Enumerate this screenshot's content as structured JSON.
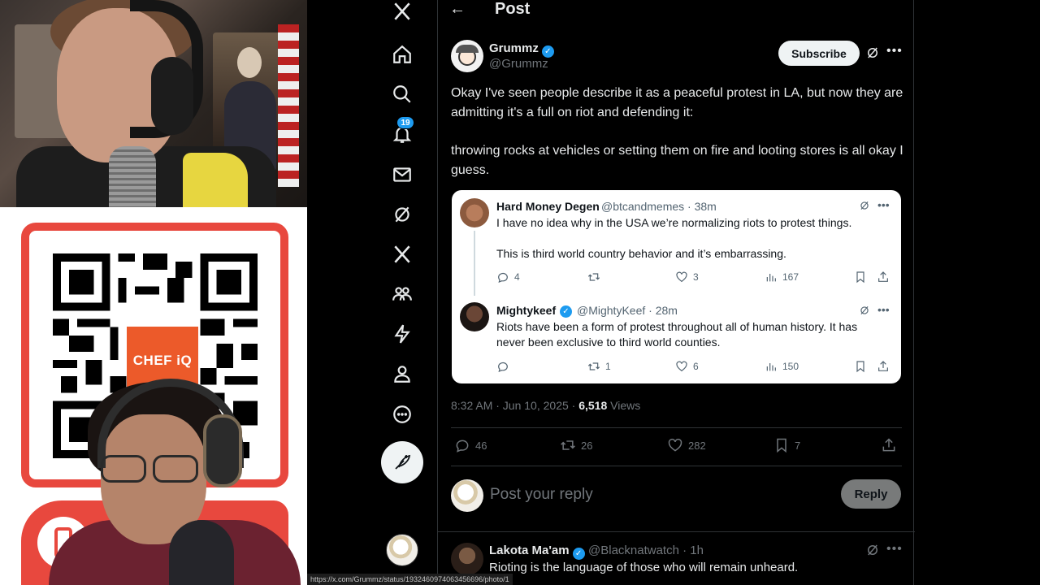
{
  "overlay": {
    "qr_logo_text": "CHEF iQ"
  },
  "nav": {
    "notification_count": "19"
  },
  "header": {
    "title": "Post"
  },
  "post": {
    "author_name": "Grummz",
    "author_handle": "@Grummz",
    "subscribe_label": "Subscribe",
    "text_line1": "Okay I've seen people describe it as a peaceful protest in LA, but now they are admitting it's a full on riot and defending it:",
    "text_line2": "throwing rocks at vehicles or setting them on fire and looting stores is all okay I guess.",
    "timestamp": "8:32 AM · Jun 10, 2025 · ",
    "views_count": "6,518",
    "views_label": " Views",
    "stats": {
      "replies": "46",
      "reposts": "26",
      "likes": "282",
      "bookmarks": "7"
    }
  },
  "quote": {
    "first": {
      "name": "Hard Money Degen",
      "meta": "@btcandmemes · 38m",
      "text1": "I have no idea why in the USA we’re normalizing riots to protest things.",
      "text2": "This is third world country behavior and it’s embarrassing.",
      "replies": "4",
      "reposts": "",
      "likes": "3",
      "views": "167"
    },
    "second": {
      "name": "Mightykeef",
      "meta": "@MightyKeef · 28m",
      "text": "Riots have been a form of protest throughout all of human history. It has never been exclusive to third world counties.",
      "replies": "",
      "reposts": "1",
      "likes": "6",
      "views": "150"
    }
  },
  "reply_box": {
    "placeholder": "Post your reply",
    "button_label": "Reply"
  },
  "next_reply": {
    "name": "Lakota Ma'am",
    "meta": "@Blacknatwatch · 1h",
    "text": "Rioting is the language of those who will remain unheard."
  },
  "statusbar": {
    "url": "https://x.com/Grummz/status/1932460974063456696/photo/1"
  },
  "colors": {
    "accent": "#1d9bf0",
    "promo": "#e8483e"
  }
}
